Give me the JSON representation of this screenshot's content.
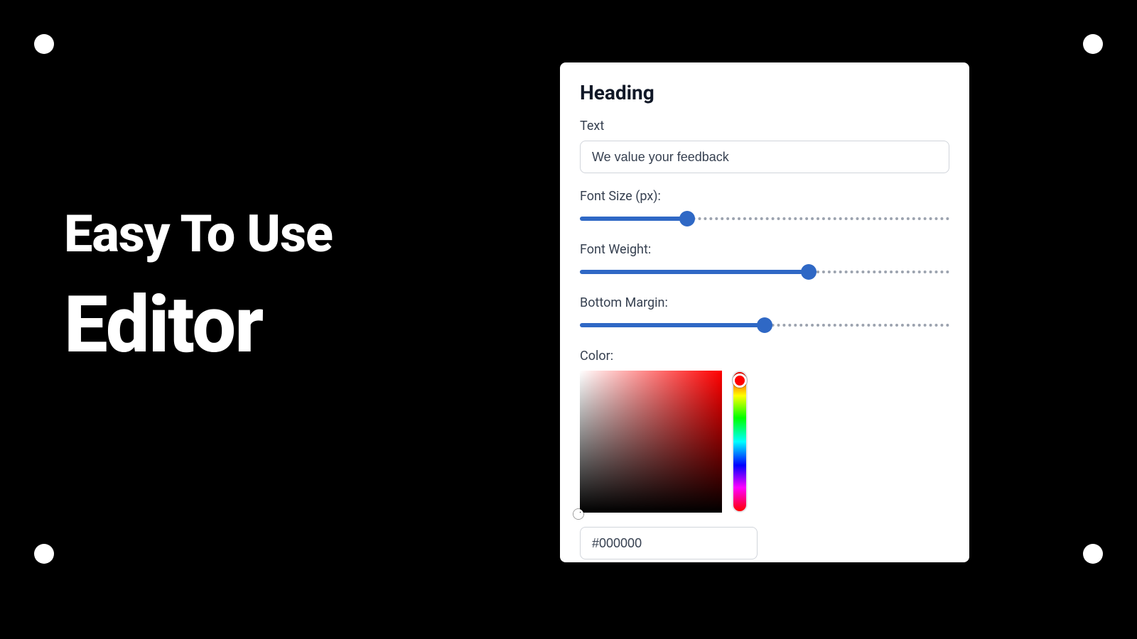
{
  "hero": {
    "line1": "Easy To Use",
    "line2": "Editor"
  },
  "panel": {
    "title": "Heading",
    "text": {
      "label": "Text",
      "value": "We value your feedback"
    },
    "font_size": {
      "label": "Font Size (px):",
      "percent": 29
    },
    "font_weight": {
      "label": "Font Weight:",
      "percent": 62
    },
    "bottom_margin": {
      "label": "Bottom Margin:",
      "percent": 50
    },
    "color": {
      "label": "Color:",
      "hex": "#000000"
    }
  }
}
